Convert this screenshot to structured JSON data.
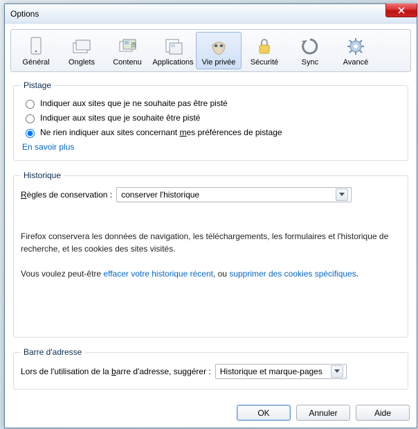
{
  "window": {
    "title": "Options"
  },
  "toolbar": {
    "items": [
      {
        "label": "Général"
      },
      {
        "label": "Onglets"
      },
      {
        "label": "Contenu"
      },
      {
        "label": "Applications"
      },
      {
        "label": "Vie privée"
      },
      {
        "label": "Sécurité"
      },
      {
        "label": "Sync"
      },
      {
        "label": "Avancé"
      }
    ],
    "selected_index": 4
  },
  "tracking": {
    "legend": "Pistage",
    "opt1": "Indiquer aux sites que je ne souhaite pas être pisté",
    "opt2": "Indiquer aux sites que je souhaite être pisté",
    "opt3_pre": "Ne rien indiquer aux sites concernant ",
    "opt3_u": "m",
    "opt3_post": "es préférences de pistage",
    "selected": 3,
    "learn_more": "En savoir plus"
  },
  "history": {
    "legend": "Historique",
    "rule_label_pre": "",
    "rule_label_u": "R",
    "rule_label_post": "ègles de conservation :",
    "rule_value": "conserver l'historique",
    "desc1": "Firefox conservera les données de navigation, les téléchargements, les formulaires et l'historique de recherche, et les cookies des sites visités.",
    "desc2_pre": "Vous voulez peut-être ",
    "desc2_link1": "effacer votre historique récent",
    "desc2_mid": ", ou ",
    "desc2_link2": "supprimer des cookies spécifiques",
    "desc2_post": "."
  },
  "addressbar": {
    "legend": "Barre d'adresse",
    "label_pre": "Lors de l'utilisation de la ",
    "label_u": "b",
    "label_post": "arre d'adresse, suggérer :",
    "value": "Historique et marque-pages"
  },
  "buttons": {
    "ok": "OK",
    "cancel": "Annuler",
    "help": "Aide"
  },
  "colors": {
    "link": "#0066cc"
  }
}
